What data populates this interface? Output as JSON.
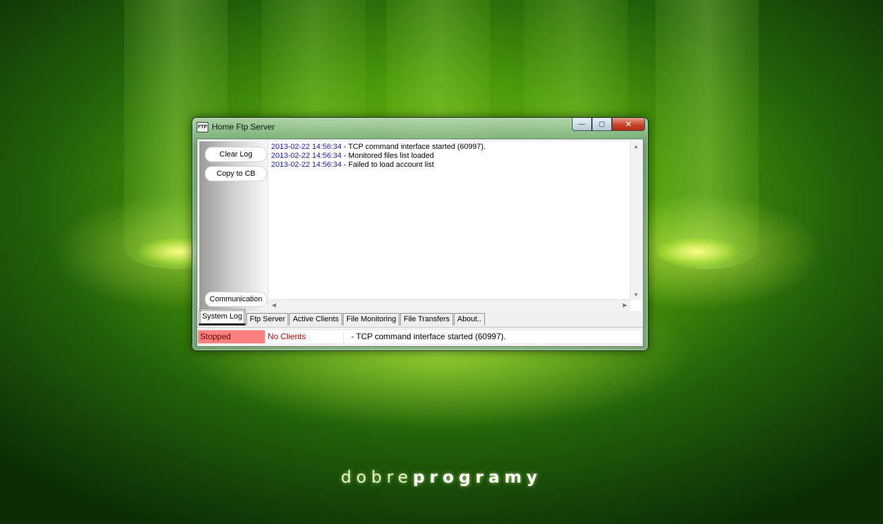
{
  "window": {
    "title": "Home Ftp Server",
    "icon_text": "FTP",
    "controls": {
      "minimize": "—",
      "maximize": "▢",
      "close": "✕"
    }
  },
  "left_panel": {
    "clear_log": "Clear Log",
    "copy_to_cb": "Copy to CB",
    "communication": "Communication"
  },
  "log": [
    {
      "ts": "2013-02-22 14:56:34",
      "msg": " - TCP command interface started (60997)."
    },
    {
      "ts": "2013-02-22 14:56:34",
      "msg": " - Monitored files list loaded"
    },
    {
      "ts": "2013-02-22 14:56:34",
      "msg": " - Failed to load account list"
    }
  ],
  "scroll": {
    "up": "▲",
    "down": "▼",
    "left": "◀",
    "right": "▶"
  },
  "tabs": [
    {
      "label": "System Log",
      "active": true
    },
    {
      "label": "Ftp Server"
    },
    {
      "label": "Active Clients"
    },
    {
      "label": "File Monitoring"
    },
    {
      "label": "File Transfers"
    },
    {
      "label": "About.."
    }
  ],
  "status": {
    "server_state": "Stopped",
    "clients": "No Clients",
    "message": "- TCP command interface started (60997)."
  },
  "wallpaper": {
    "brand_light": "dobre",
    "brand_bold": "programy"
  },
  "colors": {
    "stopped_bg": "#ff8080",
    "no_clients_text": "#c00000",
    "log_timestamp": "#1a1aa6"
  }
}
